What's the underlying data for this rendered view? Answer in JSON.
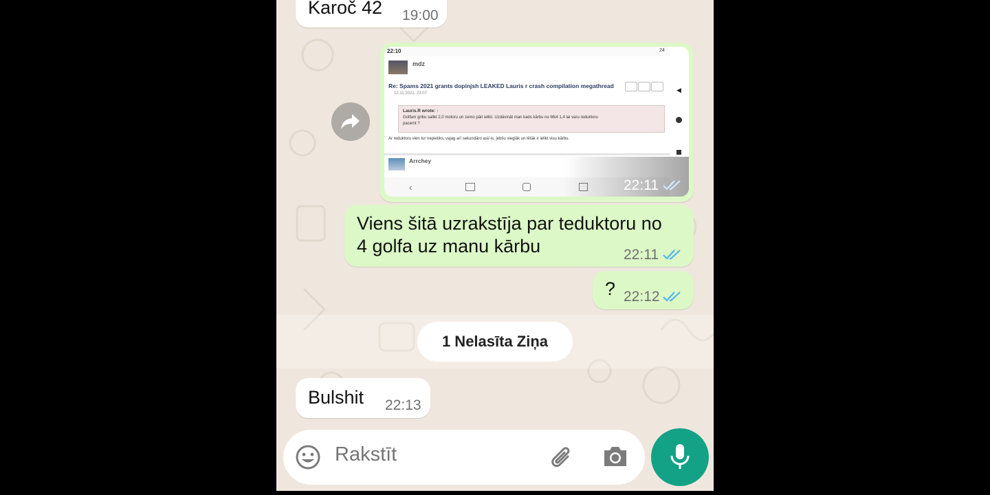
{
  "colors": {
    "chat_background": "#efe7de",
    "incoming_bubble": "#ffffff",
    "outgoing_bubble": "#dcf8c6",
    "read_ticks": "#4fb6ec",
    "mic_button": "#14a286"
  },
  "messages": [
    {
      "direction": "incoming",
      "text": "Karoč 42",
      "time": "19:00"
    },
    {
      "direction": "outgoing",
      "type": "image",
      "time": "22:11",
      "status": "read"
    },
    {
      "direction": "outgoing",
      "text_line1": "Viens šitā uzrakstīja par teduktoru no",
      "text_line2": "4 golfa uz manu kārbu",
      "time": "22:11",
      "status": "read"
    },
    {
      "direction": "outgoing",
      "text": "?",
      "time": "22:12",
      "status": "read"
    },
    {
      "direction": "incoming",
      "text": "Bulshit",
      "time": "22:13"
    }
  ],
  "image_message": {
    "status_time": "22:10",
    "battery": "24",
    "user1": "mdz",
    "thread_title": "Re: Spams 2021 grants dopinjsh LEAKED Lauris r crash compilation megathread",
    "post_date": "12.11.2021, 23:07",
    "quote_author": "Lauris.R wrote: ↑",
    "quote_line1": "Golfam gribu salikt 2,0 motoru un zemo pāri ielikt. Uzdāvināt man kads kārbu no Mk4 1,4 lai varu reduktoru",
    "quote_line2": "pacemt ?",
    "reply_text": "Ar reduktoru vien tur nepietiks, vajag arī sekundāro asi/-is, jebšu vieglāk un lētāk ir ielikt visu kārbu.",
    "user2": "Arrchey"
  },
  "unread_banner": "1 Nelasīta Ziņa",
  "composer": {
    "placeholder": "Rakstīt",
    "emoji_icon": "emoji-icon",
    "attach_icon": "paperclip-icon",
    "camera_icon": "camera-icon",
    "mic_icon": "mic-icon"
  }
}
